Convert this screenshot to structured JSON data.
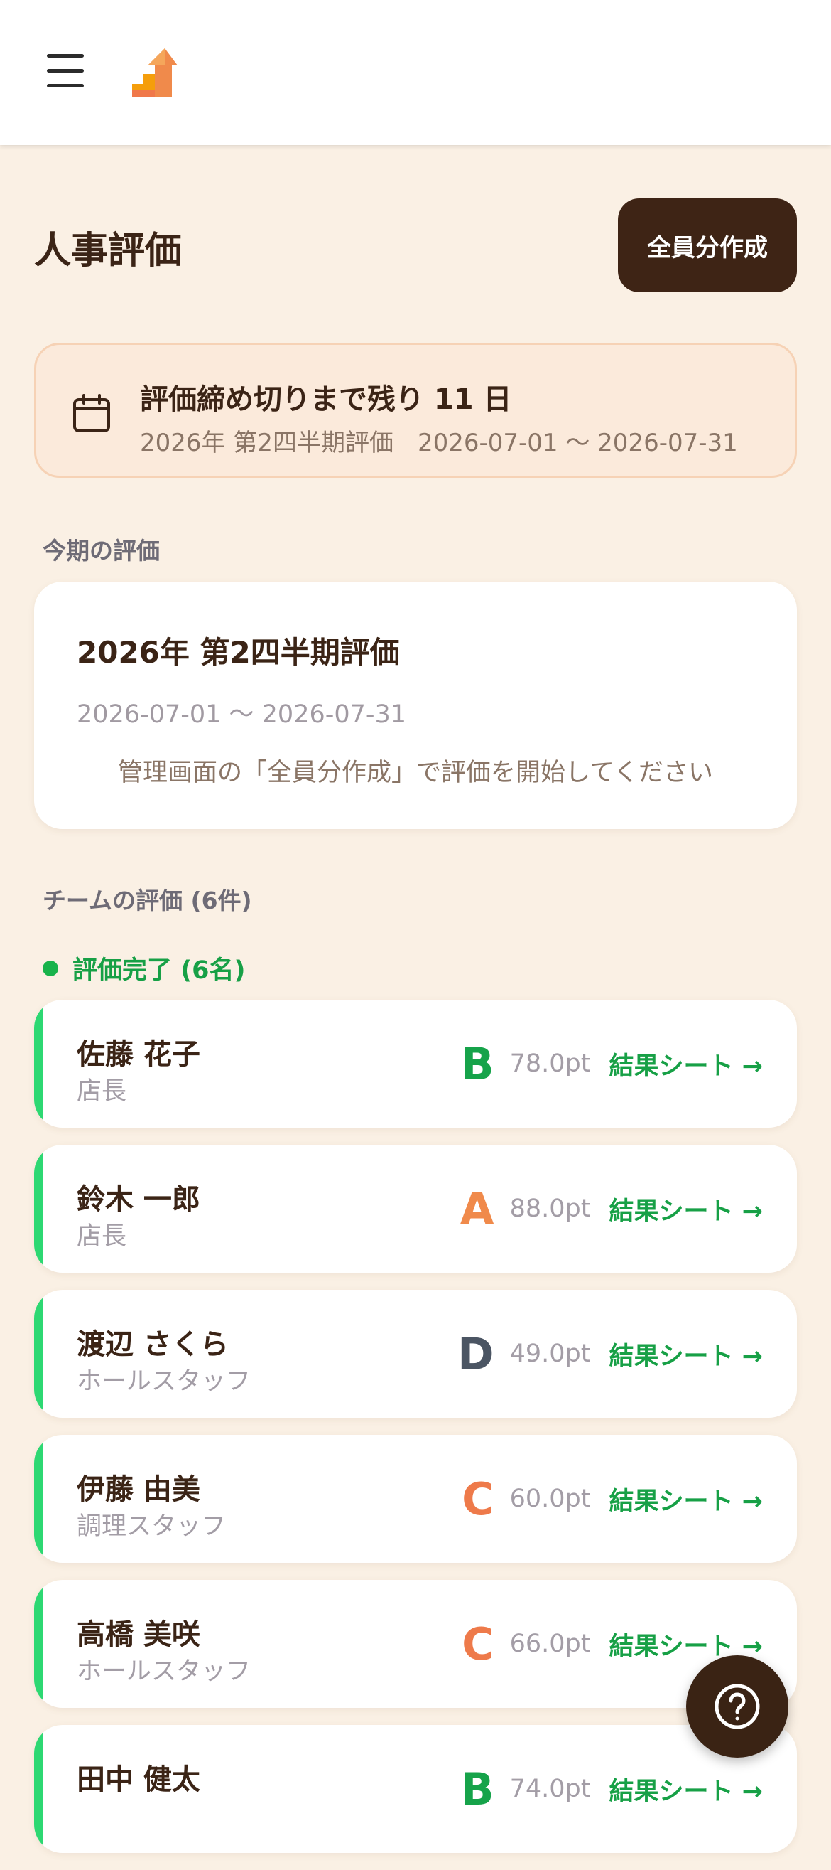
{
  "header": {
    "menu_icon": "hamburger-menu-icon",
    "logo_icon": "stairs-arrow-logo"
  },
  "page": {
    "title": "人事評価",
    "create_button": "全員分作成"
  },
  "deadline": {
    "icon": "calendar-icon",
    "title": "評価締め切りまで残り 11 日",
    "subtitle": "2026年 第2四半期評価　2026-07-01 〜 2026-07-31"
  },
  "current_period": {
    "section_label": "今期の評価",
    "title": "2026年 第2四半期評価",
    "dates": "2026-07-01 〜 2026-07-31",
    "note": "管理画面の「全員分作成」で評価を開始してください"
  },
  "team": {
    "section_label": "チームの評価 (6件)",
    "status_label": "評価完了 (6名)",
    "status_color": "#18B34B",
    "members": [
      {
        "name": "佐藤 花子",
        "role": "店長",
        "grade": "B",
        "grade_color": "#16A34A",
        "points": "78.0pt",
        "link": "結果シート →"
      },
      {
        "name": "鈴木 一郎",
        "role": "店長",
        "grade": "A",
        "grade_color": "#F08A4B",
        "points": "88.0pt",
        "link": "結果シート →"
      },
      {
        "name": "渡辺 さくら",
        "role": "ホールスタッフ",
        "grade": "D",
        "grade_color": "#4B5563",
        "points": "49.0pt",
        "link": "結果シート →"
      },
      {
        "name": "伊藤 由美",
        "role": "調理スタッフ",
        "grade": "C",
        "grade_color": "#EE7A4A",
        "points": "60.0pt",
        "link": "結果シート →"
      },
      {
        "name": "高橋 美咲",
        "role": "ホールスタッフ",
        "grade": "C",
        "grade_color": "#EE7A4A",
        "points": "66.0pt",
        "link": "結果シート →"
      },
      {
        "name": "田中 健太",
        "role": "",
        "grade": "B",
        "grade_color": "#16A34A",
        "points": "74.0pt",
        "link": "結果シート →"
      }
    ]
  },
  "help_button": {
    "icon": "question-mark-icon"
  }
}
